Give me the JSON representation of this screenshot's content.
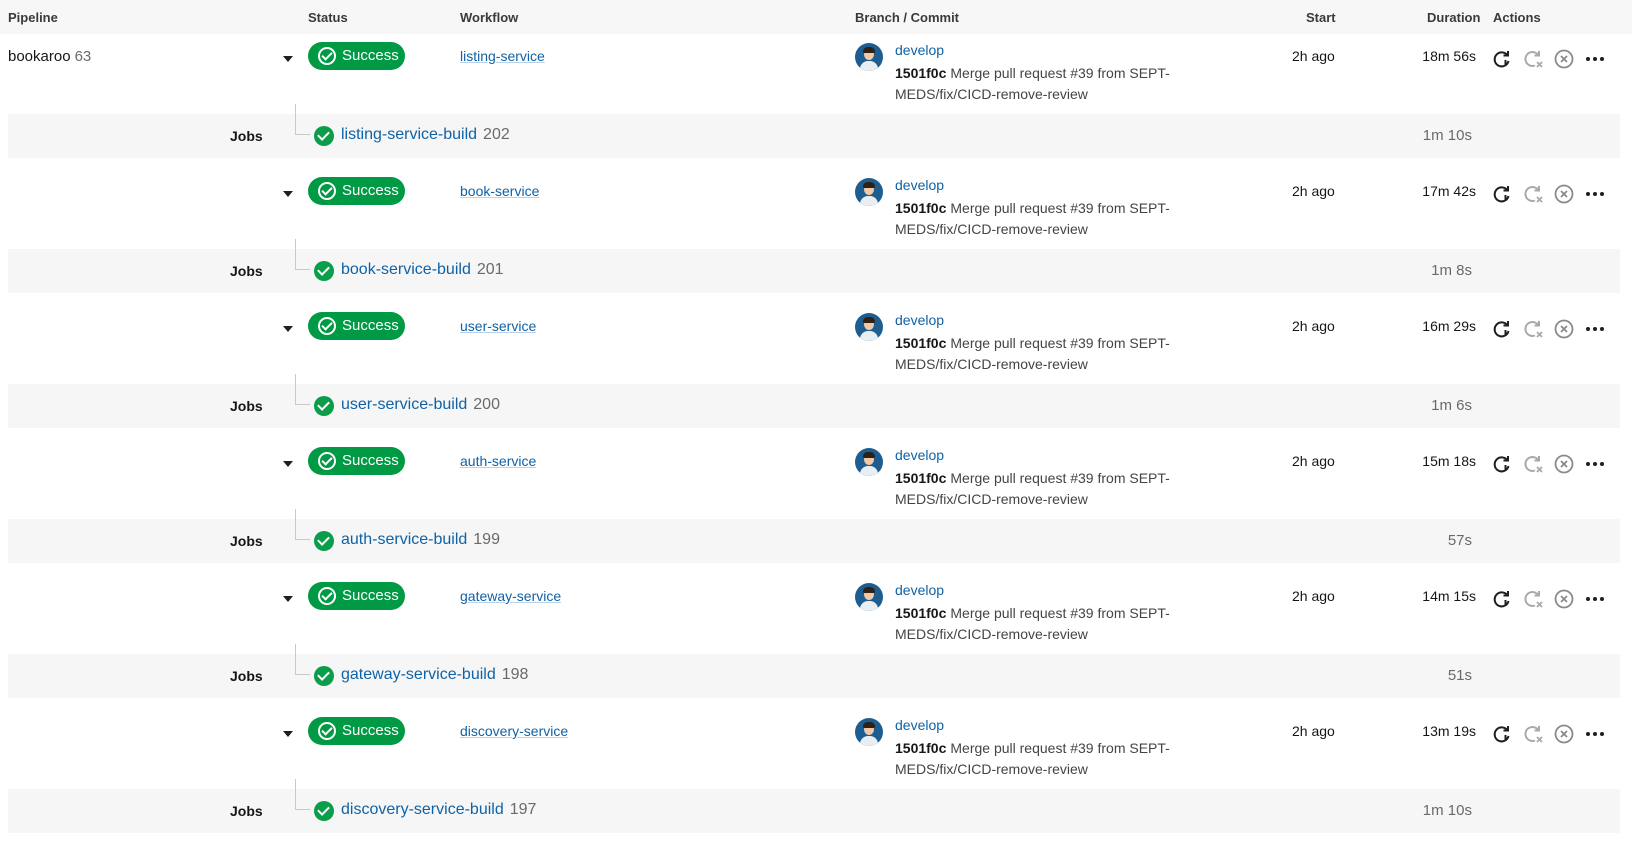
{
  "header": {
    "pipeline": "Pipeline",
    "status": "Status",
    "workflow": "Workflow",
    "branch_commit": "Branch / Commit",
    "start": "Start",
    "duration": "Duration",
    "actions": "Actions"
  },
  "pipeline": {
    "name": "bookaroo",
    "number": "63"
  },
  "colors": {
    "success": "#009a45",
    "link": "#0f62a6",
    "job_row_bg": "#f6f6f6"
  },
  "workflows": [
    {
      "status": "Success",
      "name": "listing-service",
      "branch": "develop",
      "sha": "1501f0c",
      "message": "Merge pull request #39 from SEPT-MEDS/fix/CICD-remove-review",
      "start": "2h ago",
      "duration": "18m 56s",
      "job": {
        "label": "Jobs",
        "name": "listing-service-build",
        "number": "202",
        "duration": "1m 10s"
      }
    },
    {
      "status": "Success",
      "name": "book-service",
      "branch": "develop",
      "sha": "1501f0c",
      "message": "Merge pull request #39 from SEPT-MEDS/fix/CICD-remove-review",
      "start": "2h ago",
      "duration": "17m 42s",
      "job": {
        "label": "Jobs",
        "name": "book-service-build",
        "number": "201",
        "duration": "1m 8s"
      }
    },
    {
      "status": "Success",
      "name": "user-service",
      "branch": "develop",
      "sha": "1501f0c",
      "message": "Merge pull request #39 from SEPT-MEDS/fix/CICD-remove-review",
      "start": "2h ago",
      "duration": "16m 29s",
      "job": {
        "label": "Jobs",
        "name": "user-service-build",
        "number": "200",
        "duration": "1m 6s"
      }
    },
    {
      "status": "Success",
      "name": "auth-service",
      "branch": "develop",
      "sha": "1501f0c",
      "message": "Merge pull request #39 from SEPT-MEDS/fix/CICD-remove-review",
      "start": "2h ago",
      "duration": "15m 18s",
      "job": {
        "label": "Jobs",
        "name": "auth-service-build",
        "number": "199",
        "duration": "57s"
      }
    },
    {
      "status": "Success",
      "name": "gateway-service",
      "branch": "develop",
      "sha": "1501f0c",
      "message": "Merge pull request #39 from SEPT-MEDS/fix/CICD-remove-review",
      "start": "2h ago",
      "duration": "14m 15s",
      "job": {
        "label": "Jobs",
        "name": "gateway-service-build",
        "number": "198",
        "duration": "51s"
      }
    },
    {
      "status": "Success",
      "name": "discovery-service",
      "branch": "develop",
      "sha": "1501f0c",
      "message": "Merge pull request #39 from SEPT-MEDS/fix/CICD-remove-review",
      "start": "2h ago",
      "duration": "13m 19s",
      "job": {
        "label": "Jobs",
        "name": "discovery-service-build",
        "number": "197",
        "duration": "1m 10s"
      }
    }
  ],
  "actions": [
    "rerun-icon",
    "rerun-failed-icon",
    "cancel-icon",
    "more-icon"
  ]
}
